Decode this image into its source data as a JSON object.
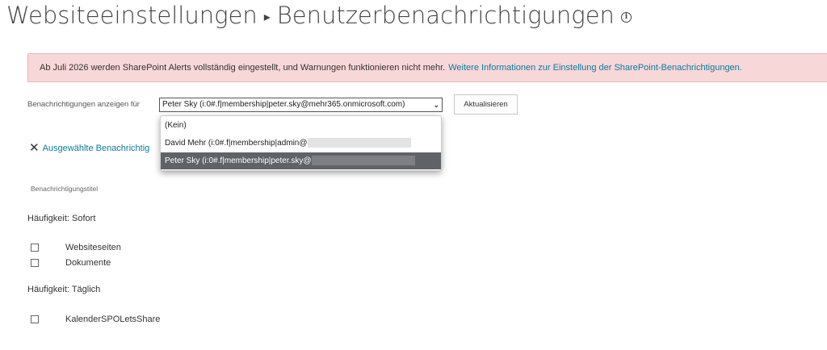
{
  "breadcrumb": {
    "parent": "Websiteeinstellungen",
    "separator": "▸",
    "current": "Benutzerbenachrichtigungen",
    "info_icon": "info-icon"
  },
  "banner": {
    "text": "Ab Juli 2026 werden SharePoint Alerts vollständig eingestellt, und Warnungen funktionieren nicht mehr.",
    "link": "Weitere Informationen zur Einstellung der SharePoint-Benachrichtigungen."
  },
  "filter": {
    "label": "Benachrichtigungen anzeigen für",
    "selected": "Peter Sky (i:0#.f|membership|peter.sky@mehr365.onmicrosoft.com)",
    "refresh_label": "Aktualisieren",
    "options": [
      {
        "label": "(Kein)"
      },
      {
        "label": "David Mehr (i:0#.f|membership|admin@"
      },
      {
        "label": "Peter Sky (i:0#.f|membership|peter.sky@"
      }
    ]
  },
  "delete_label": "Ausgewählte Benachrichtig",
  "column_header": "Benachrichtigungstitel",
  "groups": [
    {
      "title": "Häufigkeit: Sofort",
      "items": [
        {
          "label": "Websiteseiten"
        },
        {
          "label": "Dokumente"
        }
      ]
    },
    {
      "title": "Häufigkeit: Täglich",
      "items": [
        {
          "label": "KalenderSPOLetsShare"
        }
      ]
    }
  ],
  "colors": {
    "banner_bg": "#f8d7d9",
    "link": "#0a7a9c",
    "dropdown_selected": "#5f6368"
  }
}
